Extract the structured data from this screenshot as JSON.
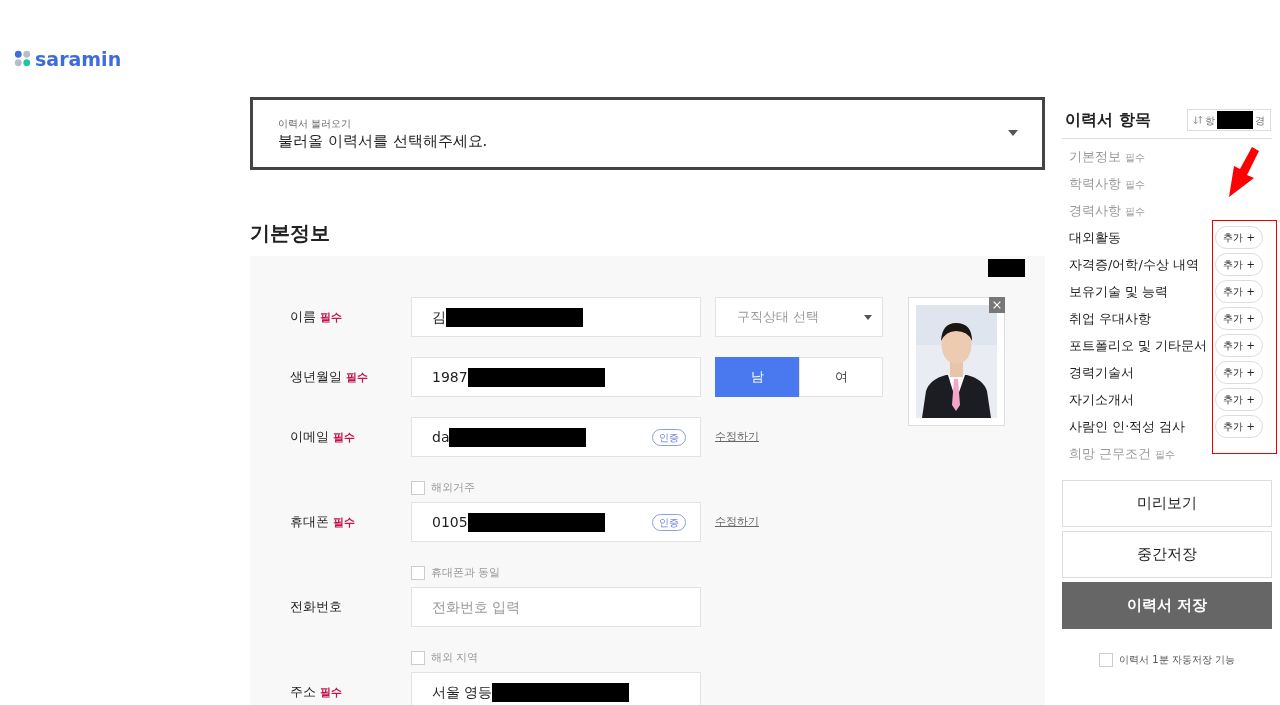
{
  "logo": {
    "text": "saramin"
  },
  "resume_loader": {
    "label": "이력서 불러오기",
    "placeholder": "불러올 이력서를 선택해주세요."
  },
  "section_title": "기본정보",
  "form": {
    "panel_redacted": true,
    "rows": [
      {
        "kind": "field",
        "label": "이름",
        "required": "필수",
        "value": "김",
        "redacted": true,
        "extra": {
          "kind": "select",
          "placeholder": "구직상태 선택"
        }
      },
      {
        "kind": "field",
        "label": "생년월일",
        "required": "필수",
        "value": "1987",
        "redacted": true,
        "extra": {
          "kind": "toggle",
          "options": [
            {
              "label": "남",
              "selected": true
            },
            {
              "label": "여",
              "selected": false
            }
          ]
        }
      },
      {
        "kind": "field",
        "label": "이메일",
        "required": "필수",
        "value": "da",
        "redacted": true,
        "verify": "인증",
        "extra": {
          "kind": "link",
          "label": "수정하기"
        }
      },
      {
        "kind": "checkbox",
        "label": "해외거주",
        "checked": false
      },
      {
        "kind": "field",
        "label": "휴대폰",
        "required": "필수",
        "value": "0105",
        "redacted": true,
        "verify": "인증",
        "extra": {
          "kind": "link",
          "label": "수정하기"
        }
      },
      {
        "kind": "checkbox",
        "label": "휴대폰과 동일",
        "checked": false
      },
      {
        "kind": "field",
        "label": "전화번호",
        "placeholder": "전화번호 입력"
      },
      {
        "kind": "checkbox",
        "label": "해외 지역",
        "checked": false
      },
      {
        "kind": "field",
        "label": "주소",
        "required": "필수",
        "value": "서울 영등",
        "redacted": true
      }
    ]
  },
  "sidebar": {
    "title": "이력서 항목",
    "sort_button": {
      "prefix": "항",
      "suffix": "경",
      "redacted": true
    },
    "items": [
      {
        "kind": "required",
        "label": "기본정보",
        "badge": "필수"
      },
      {
        "kind": "required",
        "label": "학력사항",
        "badge": "필수"
      },
      {
        "kind": "required",
        "label": "경력사항",
        "badge": "필수"
      },
      {
        "kind": "optional",
        "label": "대외활동",
        "button": "추가 +"
      },
      {
        "kind": "optional",
        "label": "자격증/어학/수상 내역",
        "button": "추가 +"
      },
      {
        "kind": "optional",
        "label": "보유기술 및 능력",
        "button": "추가 +"
      },
      {
        "kind": "optional",
        "label": "취업 우대사항",
        "button": "추가 +"
      },
      {
        "kind": "optional",
        "label": "포트폴리오 및 기타문서",
        "button": "추가 +"
      },
      {
        "kind": "optional",
        "label": "경력기술서",
        "button": "추가 +"
      },
      {
        "kind": "optional",
        "label": "자기소개서",
        "button": "추가 +"
      },
      {
        "kind": "optional",
        "label": "사람인 인·적성 검사",
        "button": "추가 +"
      },
      {
        "kind": "required",
        "label": "희망 근무조건",
        "badge": "필수"
      }
    ],
    "buttons": [
      {
        "label": "미리보기",
        "kind": "outline"
      },
      {
        "label": "중간저장",
        "kind": "outline"
      },
      {
        "label": "이력서 저장",
        "kind": "primary"
      }
    ],
    "autosave": {
      "label": "이력서 1분 자동저장 기능",
      "checked": false
    }
  },
  "annotations": {
    "arrow": true,
    "highlight_box": true
  }
}
